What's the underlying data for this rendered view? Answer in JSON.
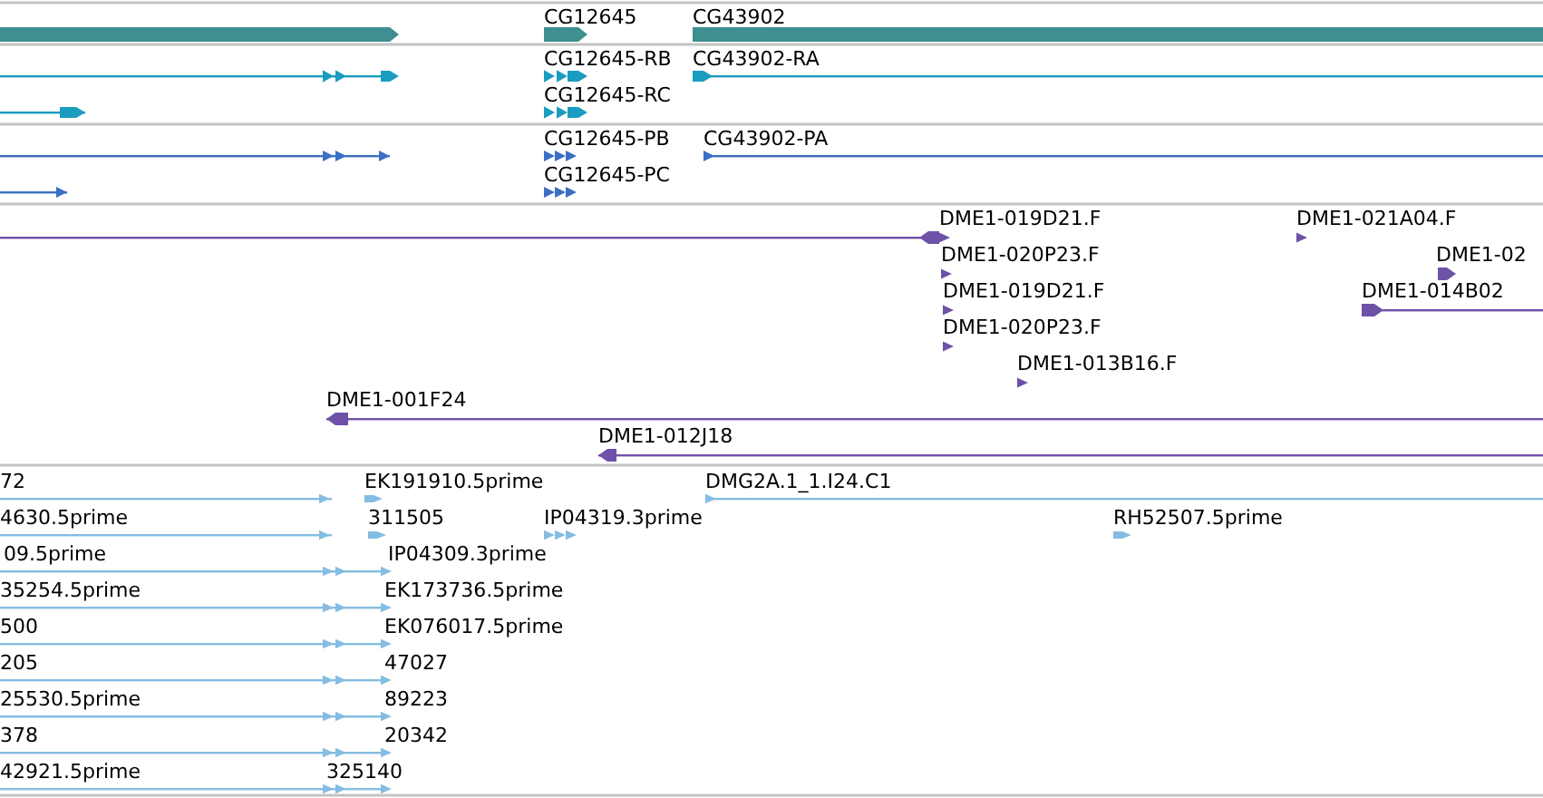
{
  "tracks": [
    {
      "kind": "gene",
      "color": "#3f8f91",
      "features": [
        {
          "reverse": false
        },
        {
          "label": "CG12645",
          "reverse": false
        },
        {
          "label": "CG43902",
          "reverse": false
        }
      ]
    },
    {
      "kind": "transcript",
      "color": "#1a9cbf",
      "features": [
        {
          "reverse": false
        },
        {
          "reverse": false
        },
        {
          "label": "CG12645-RB",
          "reverse": false
        },
        {
          "label": "CG12645-RC",
          "reverse": false
        },
        {
          "label": "CG43902-RA",
          "reverse": false
        }
      ]
    },
    {
      "kind": "protein",
      "color": "#3b6fc4",
      "features": [
        {
          "reverse": false
        },
        {
          "reverse": false
        },
        {
          "label": "CG12645-PB",
          "reverse": false
        },
        {
          "label": "CG12645-PC",
          "reverse": false
        },
        {
          "label": "CG43902-PA",
          "reverse": false
        }
      ]
    },
    {
      "kind": "clone",
      "color": "#6e52a8",
      "features": [
        {
          "reverse": true
        },
        {
          "label": "DME1-019D21.F",
          "reverse": false
        },
        {
          "label": "DME1-020P23.F",
          "reverse": false
        },
        {
          "label": "DME1-019D21.F",
          "reverse": false
        },
        {
          "label": "DME1-020P23.F",
          "reverse": false
        },
        {
          "label": "DME1-013B16.F",
          "reverse": false
        },
        {
          "label": "DME1-021A04.F",
          "reverse": false
        },
        {
          "label": "DME1-02",
          "reverse": false
        },
        {
          "label": "DME1-014B02",
          "reverse": false
        },
        {
          "label": "DME1-001F24",
          "reverse": true
        },
        {
          "label": "DME1-012J18",
          "reverse": true
        }
      ]
    },
    {
      "kind": "est",
      "color": "#85bde2",
      "features": [
        {
          "label": "72",
          "reverse": false
        },
        {
          "label": "EK191910.5prime",
          "reverse": false
        },
        {
          "label": "DMG2A.1_1.I24.C1",
          "reverse": false
        },
        {
          "label": "4630.5prime",
          "reverse": false
        },
        {
          "label": "311505",
          "reverse": false
        },
        {
          "label": "IP04319.3prime",
          "reverse": false
        },
        {
          "label": "RH52507.5prime",
          "reverse": false
        },
        {
          "label": "09.5prime",
          "reverse": false
        },
        {
          "label": "IP04309.3prime",
          "reverse": false
        },
        {
          "label": "35254.5prime",
          "reverse": false
        },
        {
          "label": "EK173736.5prime",
          "reverse": false
        },
        {
          "label": "500",
          "reverse": false
        },
        {
          "label": "EK076017.5prime",
          "reverse": false
        },
        {
          "label": "205",
          "reverse": false
        },
        {
          "label": "47027",
          "reverse": false
        },
        {
          "label": "25530.5prime",
          "reverse": false
        },
        {
          "label": "89223",
          "reverse": false
        },
        {
          "label": "378",
          "reverse": false
        },
        {
          "label": "20342",
          "reverse": false
        },
        {
          "label": "42921.5prime",
          "reverse": false
        },
        {
          "label": "325140",
          "reverse": false
        }
      ]
    }
  ]
}
